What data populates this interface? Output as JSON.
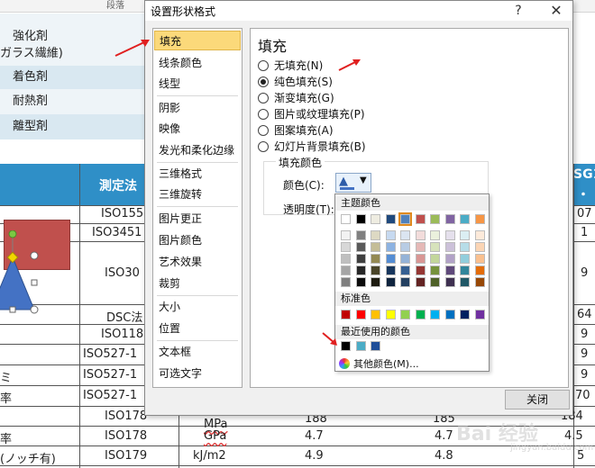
{
  "colors": {
    "accent_selected": "#fbd97a",
    "header_band": "#2f8fc7",
    "shape_fill": "#c0504d",
    "triangle_fill": "#4472c4",
    "annotation_arrow": "#e02020"
  },
  "background_sheet": {
    "ribbon_label": "段落",
    "left_rows": [
      "強化剤",
      "ガラス繊維)",
      "着色剤",
      "耐熱剤",
      "離型剤"
    ],
    "header_left": "測定法",
    "header_right_top": "SG1",
    "header_right_bottom": "・試",
    "method_col": [
      "ISO155",
      "ISO3451",
      "ISO30",
      "DSC法",
      "ISO118",
      "ISO527-1",
      "ISO527-1",
      "ISO527-1",
      "ISO178",
      "ISO178",
      "ISO179"
    ],
    "left_col": [
      "ミ",
      "率",
      "率",
      "(ノッチ有)"
    ],
    "right_col": [
      "07",
      "1",
      "9",
      "64",
      "9",
      "9",
      "9",
      "70",
      "184",
      "4.5",
      "5"
    ],
    "bottom_rows": [
      {
        "unit": "MPa",
        "v1": "188",
        "v2": "185"
      },
      {
        "unit": "GPa",
        "v1": "4.7",
        "v2": "4.7"
      },
      {
        "unit": "kJ/m2",
        "v1": "4.9",
        "v2": "4.8"
      }
    ]
  },
  "dialog": {
    "title": "设置形状格式",
    "help_glyph": "?",
    "close_glyph": "✕",
    "nav_items": [
      "填充",
      "线条颜色",
      "线型",
      "阴影",
      "映像",
      "发光和柔化边缘",
      "三维格式",
      "三维旋转",
      "图片更正",
      "图片颜色",
      "艺术效果",
      "裁剪",
      "大小",
      "位置",
      "文本框",
      "可选文字"
    ],
    "selected_nav": "填充",
    "panel_title": "填充",
    "fill_options": [
      "无填充(N)",
      "纯色填充(S)",
      "渐变填充(G)",
      "图片或纹理填充(P)",
      "图案填充(A)",
      "幻灯片背景填充(B)"
    ],
    "selected_fill": "纯色填充(S)",
    "group_label": "填充颜色",
    "color_label": "颜色(C):",
    "transparency_label": "透明度(T):",
    "close_button": "关闭"
  },
  "color_popup": {
    "theme_header": "主题颜色",
    "theme_top": [
      "#ffffff",
      "#000000",
      "#eeece1",
      "#1f497d",
      "#4f81bd",
      "#c0504d",
      "#9bbb59",
      "#8064a2",
      "#4bacc6",
      "#f79646"
    ],
    "theme_shades": [
      [
        "#f2f2f2",
        "#7f7f7f",
        "#ddd9c3",
        "#c6d9f0",
        "#dbe5f1",
        "#f2dcdb",
        "#ebf1dd",
        "#e5e0ec",
        "#dbeef3",
        "#fdeada"
      ],
      [
        "#d8d8d8",
        "#595959",
        "#c4bd97",
        "#8db3e2",
        "#b8cce4",
        "#e5b9b7",
        "#d7e3bc",
        "#ccc1d9",
        "#b7dde8",
        "#fbd5b5"
      ],
      [
        "#bfbfbf",
        "#3f3f3f",
        "#938953",
        "#548dd4",
        "#95b3d7",
        "#d99694",
        "#c3d69b",
        "#b2a2c7",
        "#92cddc",
        "#fac08f"
      ],
      [
        "#a5a5a5",
        "#262626",
        "#494429",
        "#17365d",
        "#366092",
        "#953734",
        "#76923c",
        "#5f497a",
        "#31859b",
        "#e36c09"
      ],
      [
        "#7f7f7f",
        "#0c0c0c",
        "#1d1b10",
        "#0f243e",
        "#244061",
        "#632423",
        "#4f6128",
        "#3f3151",
        "#205867",
        "#974806"
      ]
    ],
    "selected_theme_index": 4,
    "standard_header": "标准色",
    "standard": [
      "#c00000",
      "#ff0000",
      "#ffc000",
      "#ffff00",
      "#92d050",
      "#00b050",
      "#00b0f0",
      "#0070c0",
      "#002060",
      "#7030a0"
    ],
    "recent_header": "最近使用的颜色",
    "recent": [
      "#000000",
      "#4bacc6",
      "#1f4e99"
    ],
    "more_colors": "其他颜色(M)..."
  },
  "watermark": {
    "text": "Bai 经验",
    "sub": "jingyan.baidu.com"
  }
}
